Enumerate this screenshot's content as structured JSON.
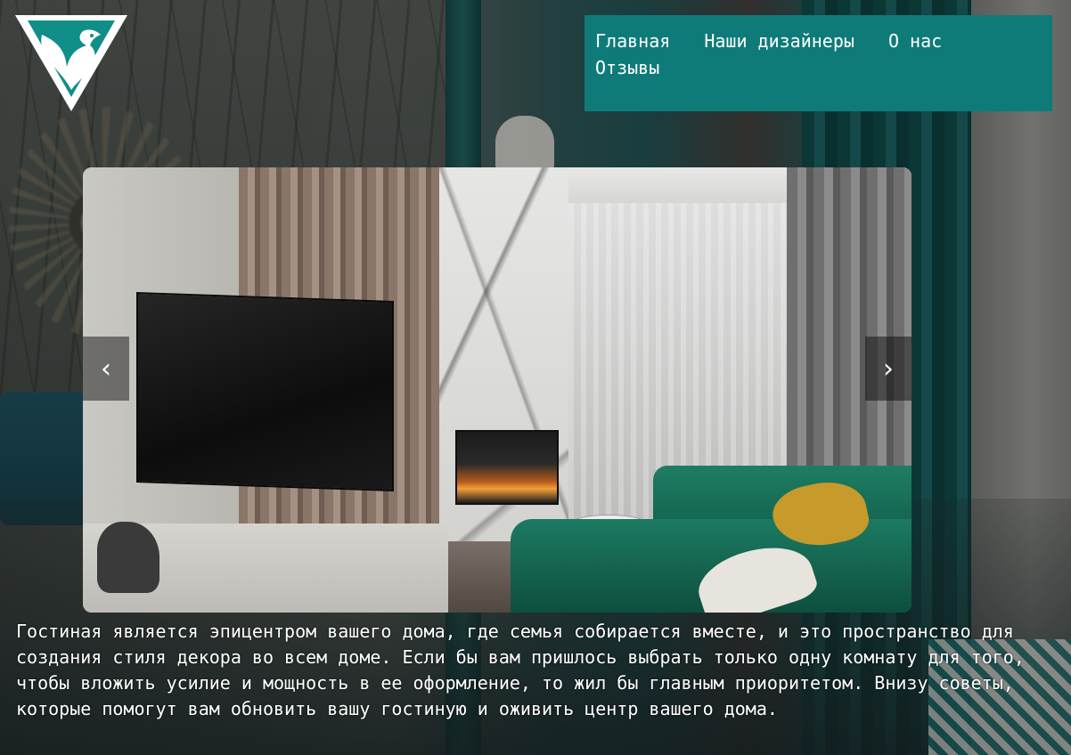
{
  "nav": {
    "items": [
      "Главная",
      "Наши дизайнеры",
      "О нас",
      "Отзывы"
    ]
  },
  "slider": {
    "prev_glyph": "‹",
    "next_glyph": "›"
  },
  "description": "Гостиная является эпицентром вашего дома, где семья собирается вместе, и это пространство для создания стиля декора во всем доме. Если бы вам пришлось выбрать только одну комнату для того, чтобы вложить усилие и мощность в ее оформление, то жил бы главным приоритетом. Внизу советы, которые помогут вам обновить вашу гостиную и оживить центр вашего дома.",
  "colors": {
    "nav_background": "#0e7b79",
    "logo_teal": "#0f8f88",
    "text": "#ffffff"
  },
  "icons": {
    "logo": "bird-shield-logo",
    "prev": "chevron-left-icon",
    "next": "chevron-right-icon"
  }
}
